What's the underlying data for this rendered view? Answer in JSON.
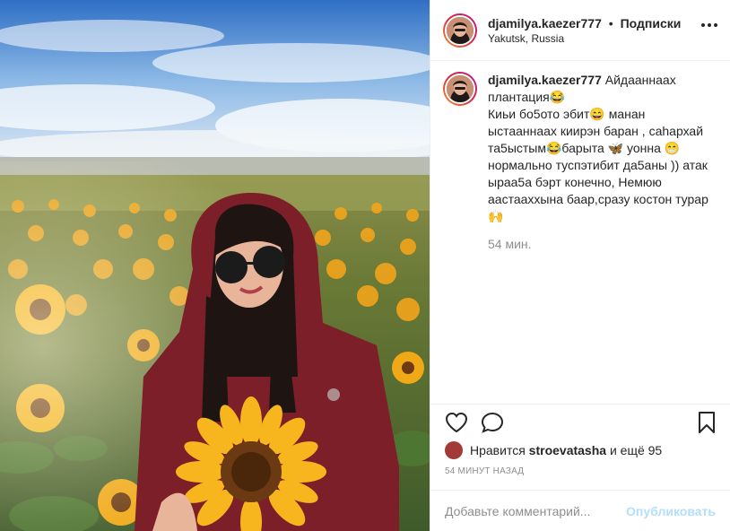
{
  "post": {
    "username": "djamilya.kaezer777",
    "dot": "•",
    "follow_label": "Подписки",
    "location": "Yakutsk, Russia"
  },
  "caption": {
    "username": "djamilya.kaezer777",
    "text": "Айдааннаах плантация😂\nКиьи бо5ото эбит😄 манан ыстааннаах киирэн баран , саһархай та5ыстым😂барыта 🦋 уонна 😁 нормально туспэтибит да5аны )) атак ыраа5а бэрт конечно, Немюю аастааххына баар,сразу костон турар 🙌",
    "time": "54 мин."
  },
  "actions": {
    "like_icon": "heart-icon",
    "comment_icon": "speech-bubble-icon",
    "save_icon": "bookmark-icon"
  },
  "likes": {
    "prefix": "Нравится",
    "user": "stroevatasha",
    "suffix": "и ещё 95"
  },
  "posted_time": "54 МИНУТ НАЗАД",
  "comment_box": {
    "placeholder": "Добавьте комментарий...",
    "publish_label": "Опубликовать"
  },
  "colors": {
    "accent_disabled": "#b2dffc",
    "muted": "#8e8e8e",
    "text": "#262626"
  }
}
